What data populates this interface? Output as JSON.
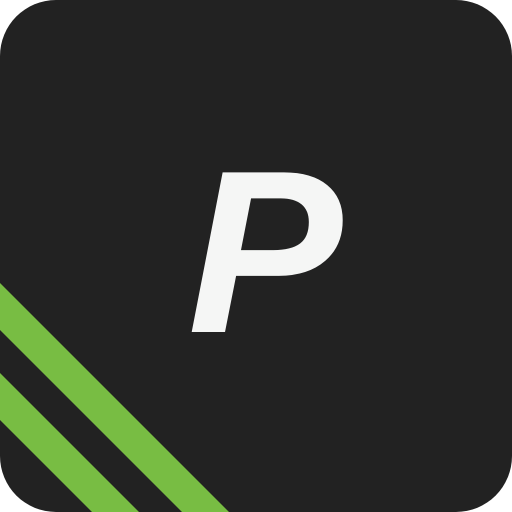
{
  "icon": {
    "letter": "P",
    "background_color": "#222222",
    "letter_color": "#f5f6f5",
    "stripe_color": "#78bd43",
    "stripe_count": 2
  }
}
